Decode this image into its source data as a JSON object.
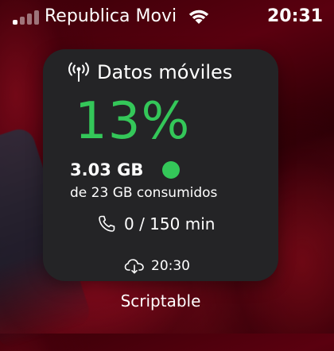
{
  "status_bar": {
    "carrier": "Republica Movi",
    "time": "20:31",
    "signal_bars_active": 1,
    "signal_bars_total": 4,
    "wifi_icon": "wifi-icon"
  },
  "widget": {
    "title_icon": "antenna-icon",
    "title": "Datos móviles",
    "percent": "13%",
    "used": "3.03 GB",
    "status_dot_color": "#34c759",
    "consumed": "de 23 GB consumidos",
    "minutes_icon": "phone-icon",
    "minutes": "0 / 150 min",
    "updated_icon": "cloud-download-icon",
    "updated": "20:30",
    "accent_color": "#34c759"
  },
  "widget_label": "Scriptable"
}
